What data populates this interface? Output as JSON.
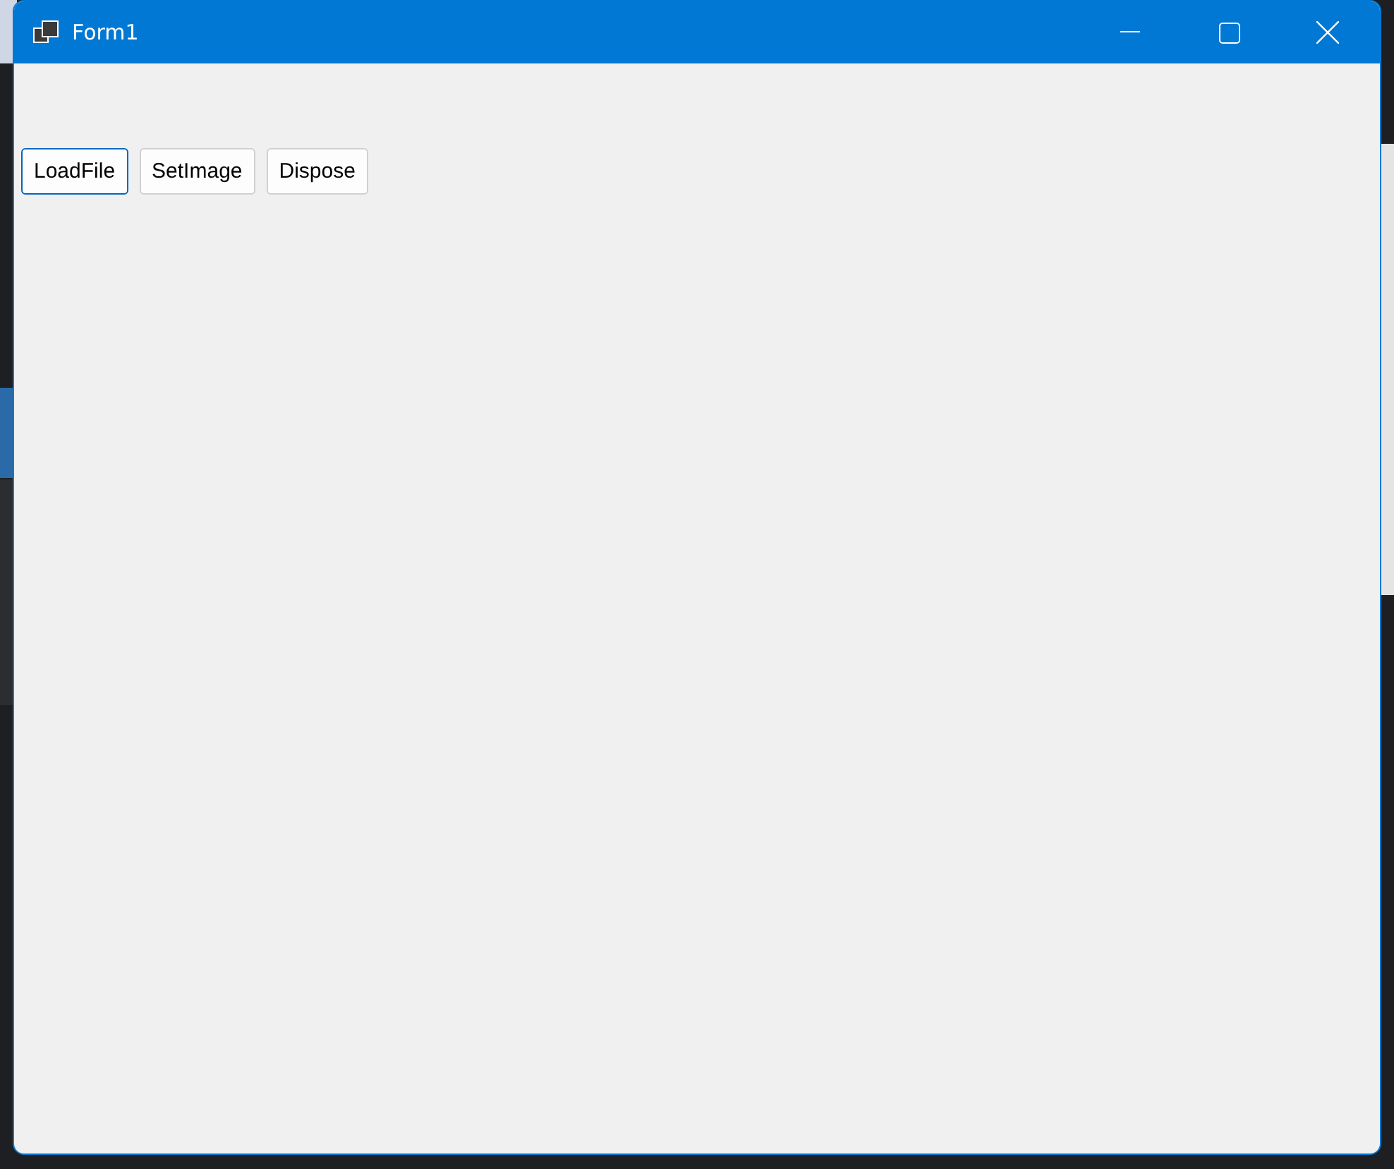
{
  "window": {
    "title": "Form1"
  },
  "title_buttons": [
    {
      "kind": "minimize"
    },
    {
      "kind": "maximize"
    },
    {
      "kind": "close"
    }
  ],
  "buttons": [
    {
      "label": "LoadFile",
      "focused": true
    },
    {
      "label": "SetImage",
      "focused": false
    },
    {
      "label": "Dispose",
      "focused": false
    }
  ]
}
